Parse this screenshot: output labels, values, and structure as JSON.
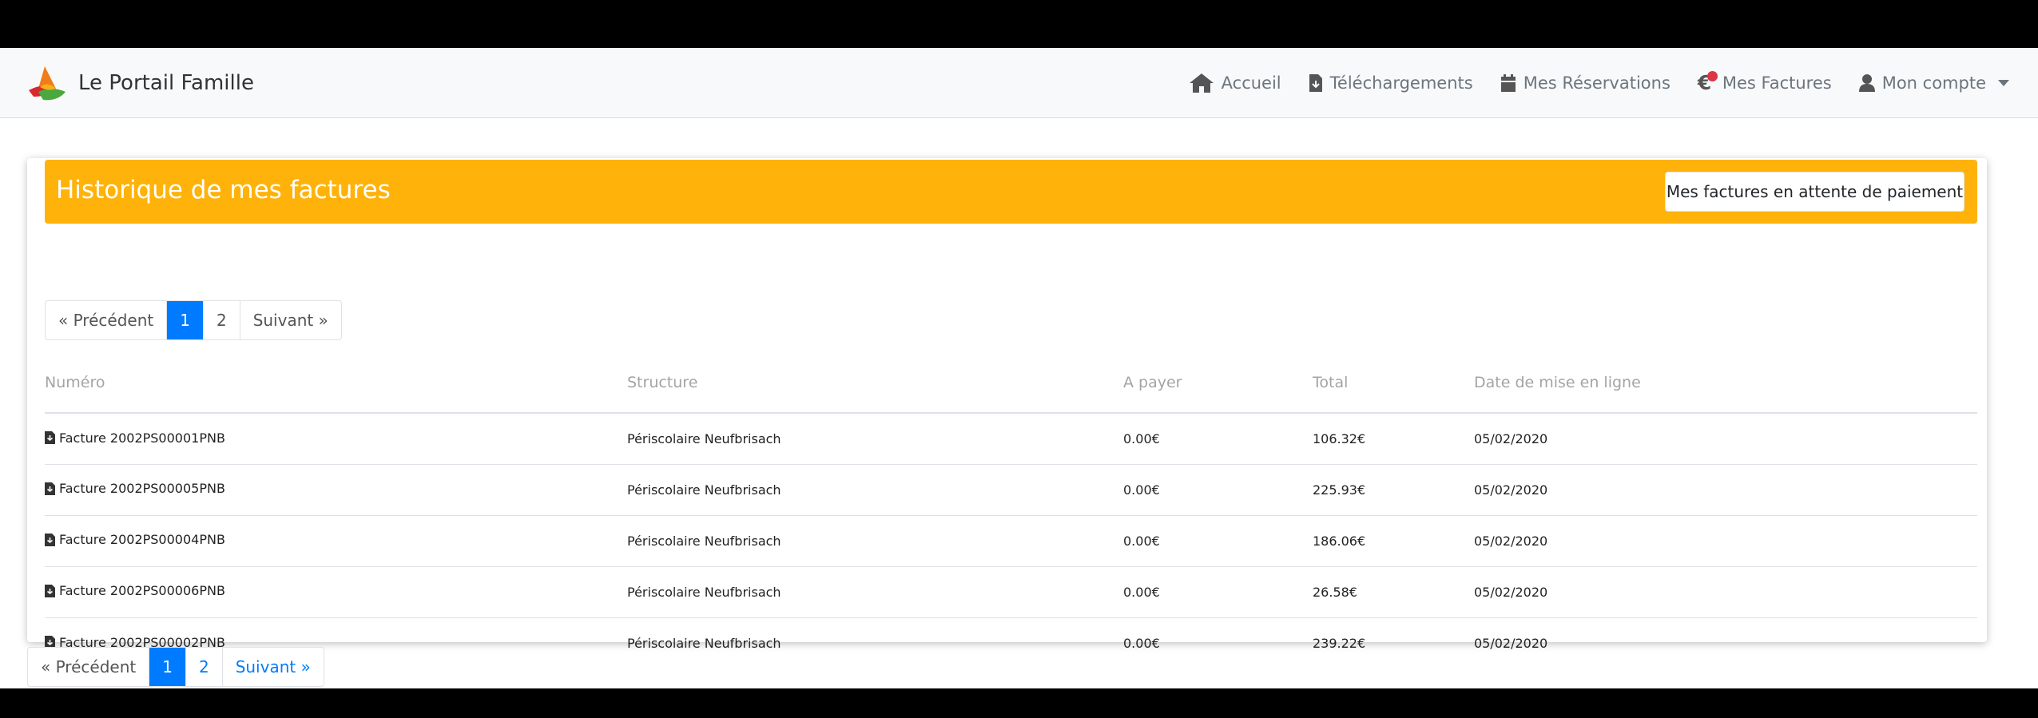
{
  "navbar": {
    "brand": "Le Portail Famille",
    "items": [
      {
        "label": "Accueil",
        "icon": "home-icon"
      },
      {
        "label": "Téléchargements",
        "icon": "file-download-icon"
      },
      {
        "label": "Mes Réservations",
        "icon": "calendar-icon"
      },
      {
        "label": "Mes Factures",
        "icon": "euro-icon"
      },
      {
        "label": "Mon compte",
        "icon": "user-icon"
      }
    ]
  },
  "card": {
    "title": "Historique de mes factures",
    "pending_button": "Mes factures en attente de paiement"
  },
  "pagination": {
    "prev": "« Précédent",
    "pages": [
      "1",
      "2"
    ],
    "active": "1",
    "next": "Suivant »"
  },
  "table": {
    "headers": [
      "Numéro",
      "Structure",
      "A payer",
      "Total",
      "Date de mise en ligne"
    ],
    "rows": [
      {
        "numero": "Facture 2002PS00001PNB",
        "structure": "Périscolaire Neufbrisach",
        "a_payer": "0.00€",
        "total": "106.32€",
        "date": "05/02/2020"
      },
      {
        "numero": "Facture 2002PS00005PNB",
        "structure": "Périscolaire Neufbrisach",
        "a_payer": "0.00€",
        "total": "225.93€",
        "date": "05/02/2020"
      },
      {
        "numero": "Facture 2002PS00004PNB",
        "structure": "Périscolaire Neufbrisach",
        "a_payer": "0.00€",
        "total": "186.06€",
        "date": "05/02/2020"
      },
      {
        "numero": "Facture 2002PS00006PNB",
        "structure": "Périscolaire Neufbrisach",
        "a_payer": "0.00€",
        "total": "26.58€",
        "date": "05/02/2020"
      },
      {
        "numero": "Facture 2002PS00002PNB",
        "structure": "Périscolaire Neufbrisach",
        "a_payer": "0.00€",
        "total": "239.22€",
        "date": "05/02/2020"
      }
    ]
  },
  "colors": {
    "header_orange": "#ffb20a",
    "active_page": "#007bff",
    "notification_dot": "#dc3545"
  }
}
